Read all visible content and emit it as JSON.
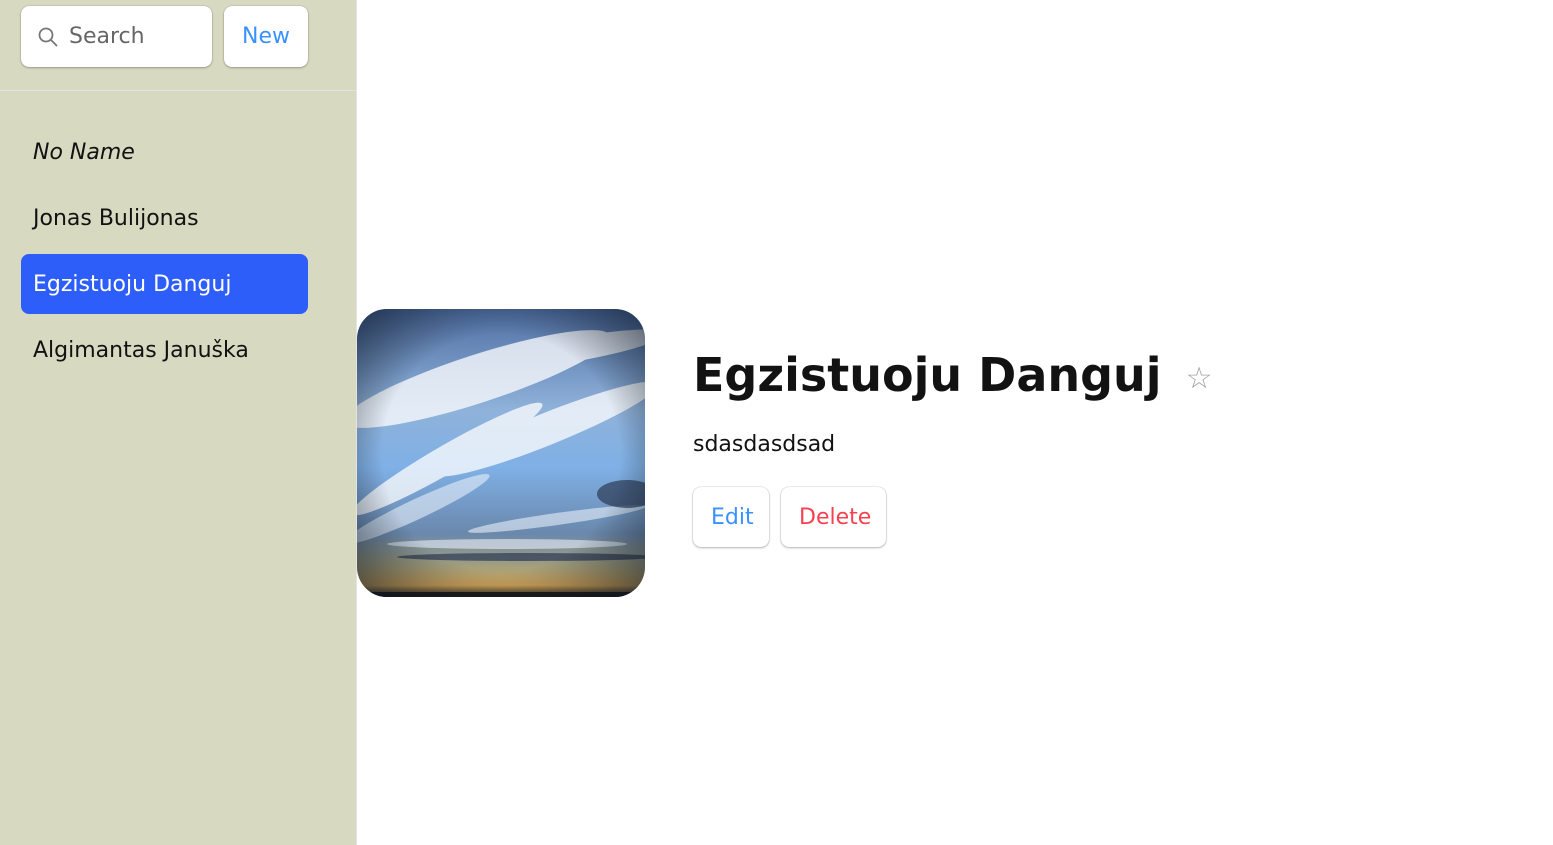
{
  "sidebar": {
    "search": {
      "placeholder": "Search",
      "value": ""
    },
    "new_label": "New",
    "contacts": [
      {
        "label": "No Name",
        "style": "italic"
      },
      {
        "label": "Jonas Bulijonas"
      },
      {
        "label": "Egzistuoju Danguj",
        "selected": true
      },
      {
        "label": "Algimantas Januška"
      }
    ]
  },
  "detail": {
    "name": "Egzistuoju Danguj",
    "favorite_icon": "☆",
    "notes": "sdasdasdsad",
    "edit_label": "Edit",
    "delete_label": "Delete",
    "avatar_image": "sky-with-clouds-at-sunset"
  },
  "colors": {
    "sidebar_bg": "#d8d9c1",
    "selected_bg": "#2d5ef9",
    "accent": "#3992ff",
    "danger": "#f44250"
  }
}
